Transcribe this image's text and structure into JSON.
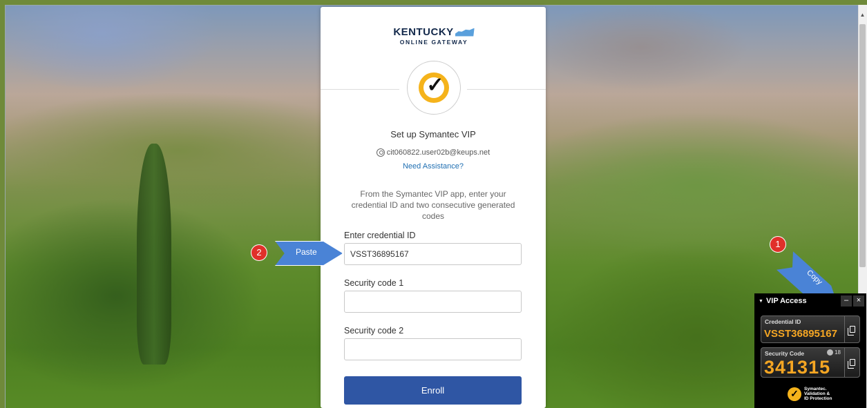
{
  "login": {
    "logo_main": "KENTUCKY",
    "logo_sub": "ONLINE GATEWAY",
    "title": "Set up Symantec VIP",
    "user_email": "cit060822.user02b@keups.net",
    "assistance_link": "Need Assistance?",
    "instructions": "From the Symantec VIP app, enter your credential ID and two consecutive generated codes",
    "credential_label": "Enter credential ID",
    "credential_value": "VSST36895167",
    "code1_label": "Security code 1",
    "code1_value": "",
    "code2_label": "Security code 2",
    "code2_value": "",
    "enroll_label": "Enroll"
  },
  "annotations": {
    "step1": "1",
    "step2": "2",
    "paste_label": "Paste",
    "copy_label": "Copy"
  },
  "vip_access": {
    "title": "VIP Access",
    "minimize": "–",
    "close": "×",
    "credential_label": "Credential ID",
    "credential_value": "VSST36895167",
    "security_label": "Security Code",
    "timer": "18",
    "security_value": "341315",
    "brand_line1": "Symantec.",
    "brand_line2": "Validation &",
    "brand_line3": "ID Protection"
  },
  "colors": {
    "enroll_button": "#2f56a4",
    "link": "#1f6fb2",
    "callout_arrow": "#4a83d6",
    "step_badge": "#e0302a",
    "vip_code": "#f5a623"
  }
}
